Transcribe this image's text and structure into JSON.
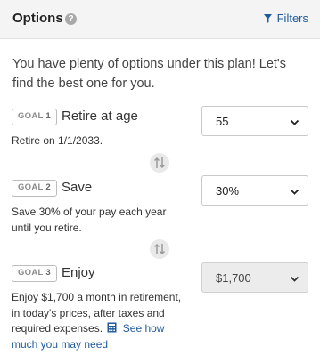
{
  "header": {
    "title": "Options",
    "help_icon": "question-circle-icon",
    "filters_label": "Filters",
    "filters_icon": "funnel-icon"
  },
  "intro": "You have plenty of options under this plan! Let's find the best one for you.",
  "goals": [
    {
      "badge_word": "GOAL",
      "badge_num": "1",
      "title": "Retire at age",
      "subtitle": "Retire on 1/1/2033.",
      "select_value": "55",
      "disabled": false
    },
    {
      "badge_word": "GOAL",
      "badge_num": "2",
      "title": "Save",
      "subtitle": "Save 30% of your pay each year until you retire.",
      "select_value": "30%",
      "disabled": false
    },
    {
      "badge_word": "GOAL",
      "badge_num": "3",
      "title": "Enjoy",
      "subtitle": "Enjoy $1,700 a month in retirement, in today's prices, after taxes and required expenses.",
      "link_text_1": "See how",
      "link_text_2": "much you may need",
      "select_value": "$1,700",
      "disabled": true
    }
  ],
  "icons": {
    "swap": "swap-vertical-icon",
    "chevron": "chevron-down-icon",
    "calculator": "calculator-icon"
  },
  "colors": {
    "header_bg": "#f4f4f4",
    "link": "#1f5a99",
    "badge_border": "#bdbdbd",
    "disabled_select_bg": "#ececec"
  }
}
